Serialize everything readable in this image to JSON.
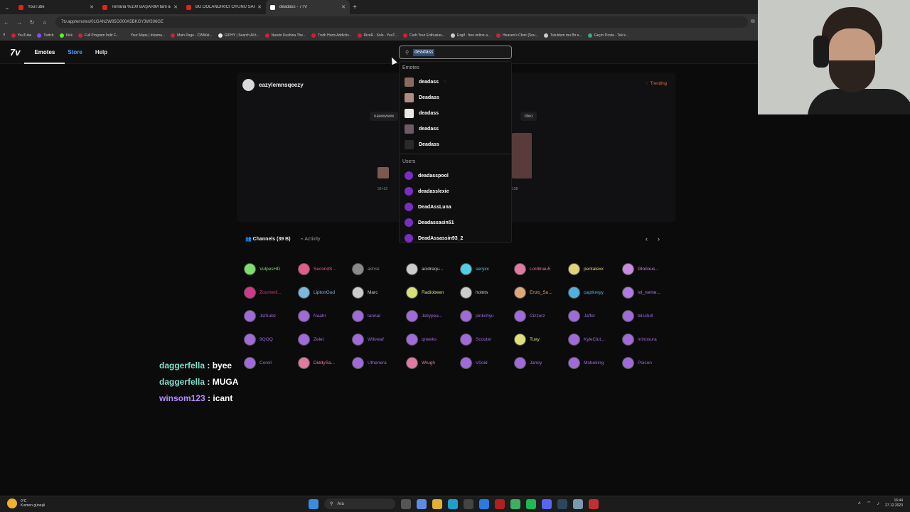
{
  "browser": {
    "tabs": [
      {
        "title": "YouTube",
        "color": "#e62117",
        "active": false
      },
      {
        "title": "Terraria %100 BAŞARIM tam ar",
        "color": "#e62117",
        "active": false
      },
      {
        "title": "BU DOLANDIRICI OYUNU SAKI",
        "color": "#e62117",
        "active": false
      },
      {
        "title": "deadass - 7TV",
        "color": "#ffffff",
        "active": true
      }
    ],
    "url": "7tv.app/emotes/01GAN2W85G000A5BKGY3W306GE",
    "bookmarks": [
      "YouTube",
      "Twitch",
      "Kick",
      "Full Program İndir F...",
      "Your Maps | Inkama...",
      "Main Page - CWWat...",
      "GIPHY | Search All t...",
      "Naruto Kushina The...",
      "Truth Hurts Addictiv...",
      "RiveR - Solo - YouT...",
      "Curb Your Enthusias...",
      "Ezgif - free online a...",
      "Heaven's Choir [Sou...",
      "Tutuldum mu Bir e...",
      "Geçici Posta - Tek k..."
    ]
  },
  "site": {
    "logo": "7v",
    "nav": [
      {
        "label": "Emotes",
        "active": true
      },
      {
        "label": "Store",
        "active": false
      },
      {
        "label": "Help",
        "active": false
      }
    ],
    "search_value": "deadass"
  },
  "emote_card": {
    "owner": "eazylemnsqeezy",
    "trending": "Trending",
    "tags": [
      "nawwwww",
      "libro"
    ],
    "size_small": "32×32",
    "size_large": "128"
  },
  "dropdown": {
    "emotes_header": "Emotes",
    "emotes": [
      {
        "name": "deadass",
        "color": "#8a6a5f",
        "extra": "◌"
      },
      {
        "name": "Deadass",
        "color": "#b08c80"
      },
      {
        "name": "deadass",
        "color": "#e8e8e8"
      },
      {
        "name": "deadass",
        "color": "#6d5a66"
      },
      {
        "name": "Deadass",
        "color": "#2a2a2a"
      }
    ],
    "users_header": "Users",
    "users": [
      "deadasspool",
      "deadasslexie",
      "DeadAssLuna",
      "Deadassasin51",
      "DeadAssassin93_2"
    ]
  },
  "channels": {
    "tab_channels": "Channels (39 B)",
    "tab_activity": "Activity",
    "list": [
      {
        "name": "VulpesHD",
        "color": "#7be06b"
      },
      {
        "name": "SecondS...",
        "color": "#e35b8a"
      },
      {
        "name": "ashsii",
        "color": "#8a8a8a"
      },
      {
        "name": "acidrequ...",
        "color": "#cccccc"
      },
      {
        "name": "seryxx",
        "color": "#4fd1e0"
      },
      {
        "name": "Lordmau5",
        "color": "#e07aa0"
      },
      {
        "name": "pentalexx",
        "color": "#e0d37a"
      },
      {
        "name": "Glorious...",
        "color": "#c98be0"
      },
      {
        "name": "Zoomeril...",
        "color": "#d0388a"
      },
      {
        "name": "LiptonGod",
        "color": "#7ab8e0"
      },
      {
        "name": "Marc",
        "color": "#cccccc"
      },
      {
        "name": "Radiobeen",
        "color": "#d8e07a"
      },
      {
        "name": "holnts",
        "color": "#cccccc"
      },
      {
        "name": "Enzo_Su...",
        "color": "#e0a87a"
      },
      {
        "name": "captkreyy",
        "color": "#4fb0e0"
      },
      {
        "name": "lol_neme...",
        "color": "#b07ae0"
      },
      {
        "name": "JstSubz",
        "color": "#a06ad8"
      },
      {
        "name": "Naahr",
        "color": "#a06ad8"
      },
      {
        "name": "tannar",
        "color": "#a06ad8"
      },
      {
        "name": "Jellypea...",
        "color": "#a06ad8"
      },
      {
        "name": "pinkchyu",
        "color": "#a06ad8"
      },
      {
        "name": "Cizzorz",
        "color": "#a06ad8"
      },
      {
        "name": "Jaffer",
        "color": "#a06ad8"
      },
      {
        "name": "blissfull",
        "color": "#a06ad8"
      },
      {
        "name": "9QOQ",
        "color": "#a06ad8"
      },
      {
        "name": "Zelet",
        "color": "#a06ad8"
      },
      {
        "name": "Wilowaf",
        "color": "#a06ad8"
      },
      {
        "name": "qneeks",
        "color": "#a06ad8"
      },
      {
        "name": "Scouter",
        "color": "#a06ad8"
      },
      {
        "name": "Tuxy",
        "color": "#e0e07a"
      },
      {
        "name": "KyleClut...",
        "color": "#a06ad8"
      },
      {
        "name": "minosura",
        "color": "#a06ad8"
      },
      {
        "name": "Corell",
        "color": "#a06ad8"
      },
      {
        "name": "DiddySa...",
        "color": "#e07aa0"
      },
      {
        "name": "Uthenera",
        "color": "#a06ad8"
      },
      {
        "name": "Wrugh",
        "color": "#e07aa0"
      },
      {
        "name": "V0oid",
        "color": "#a06ad8"
      },
      {
        "name": "Janey",
        "color": "#a06ad8"
      },
      {
        "name": "Moboking",
        "color": "#a06ad8"
      },
      {
        "name": "Poison",
        "color": "#a06ad8"
      }
    ]
  },
  "chat": [
    {
      "user": "daggerfella",
      "msg": "byee",
      "style": "n1"
    },
    {
      "user": "daggerfella",
      "msg": "MUGA",
      "style": "n1"
    },
    {
      "user": "winsom123",
      "msg": "icant",
      "style": "n2"
    }
  ],
  "taskbar": {
    "weather_temp": "0°C",
    "weather_desc": "Kısmen güneşli",
    "search_label": "Ara",
    "time": "16:44",
    "date": "27.12.2023"
  }
}
